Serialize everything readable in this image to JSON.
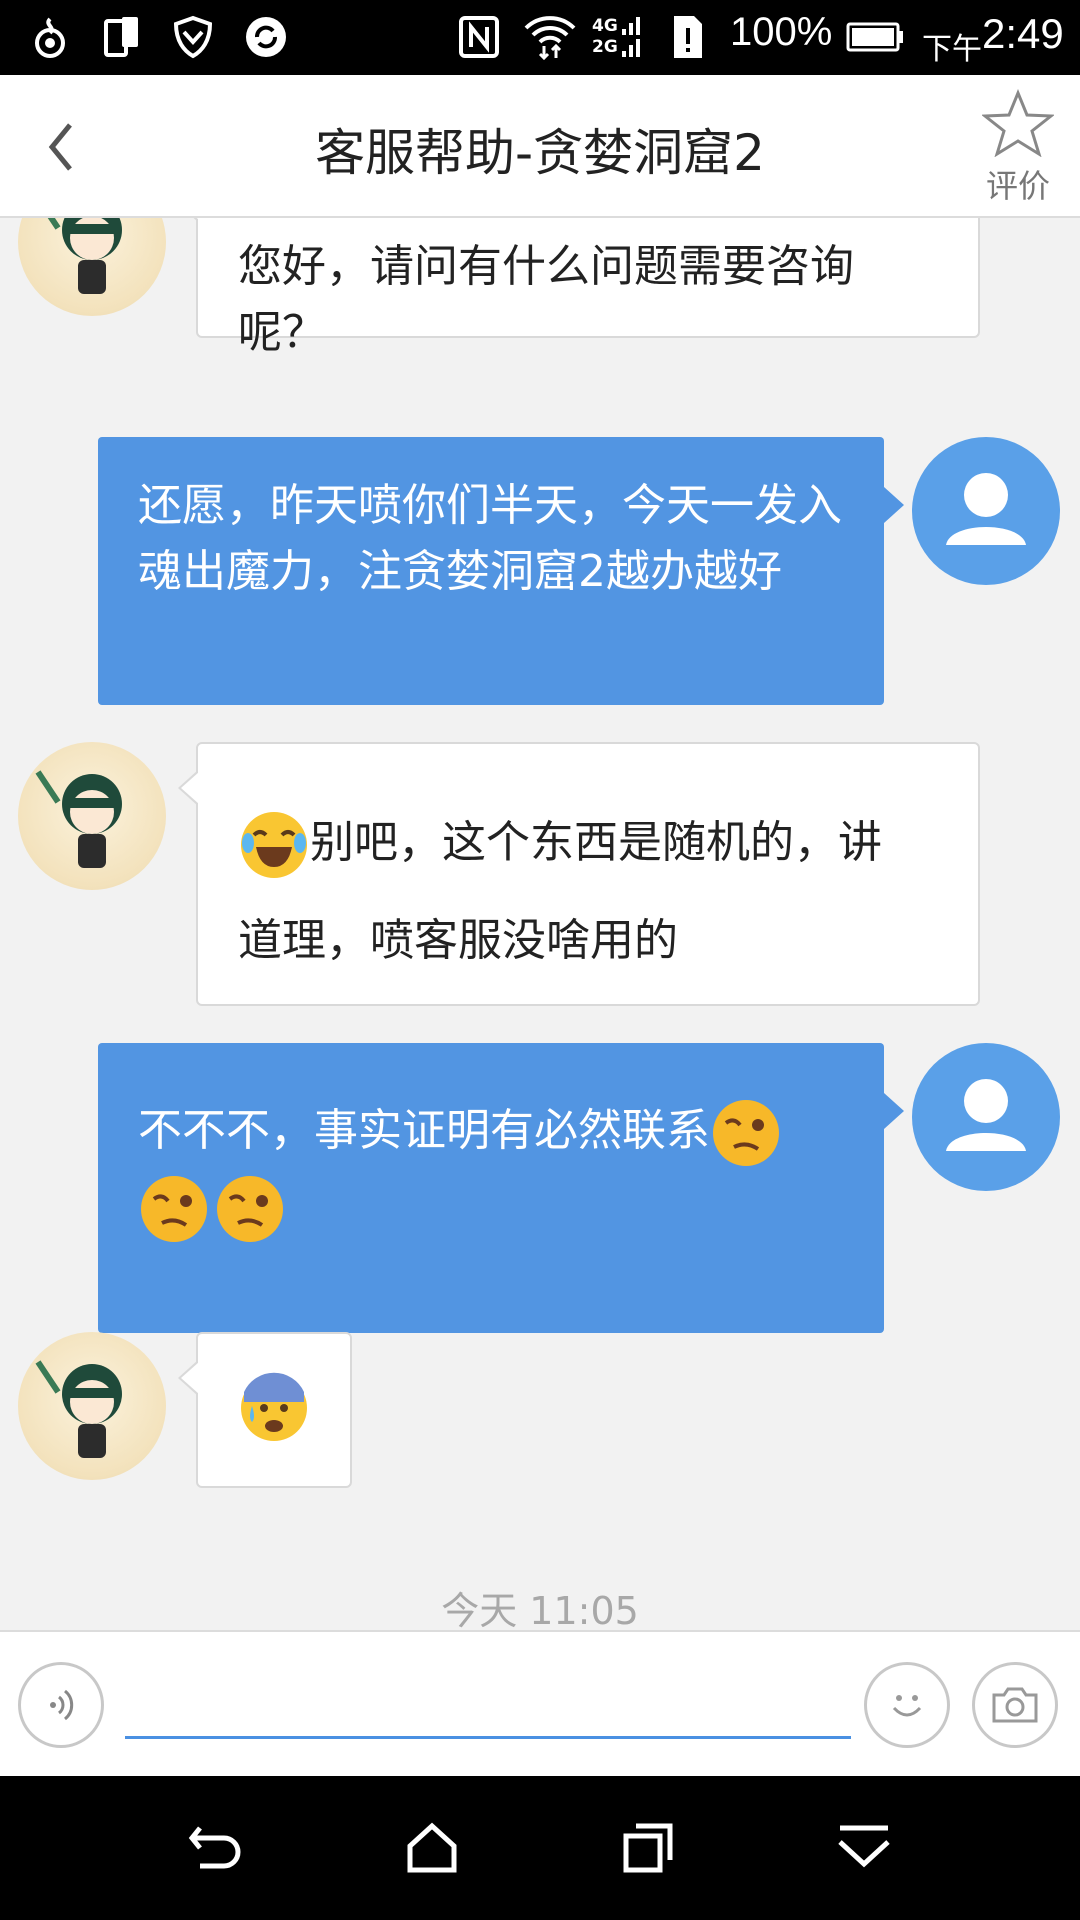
{
  "status_bar": {
    "battery": "100%",
    "time_prefix": "下午",
    "time": "2:49",
    "net_4g": "4G",
    "net_2g": "2G"
  },
  "header": {
    "title": "客服帮助-贪婪洞窟2",
    "rate_label": "评价"
  },
  "messages": [
    {
      "side": "in",
      "text": "您好，请问有什么问题需要咨询呢？"
    },
    {
      "side": "out",
      "text": "还愿，昨天喷你们半天，今天一发入魂出魔力，注贪婪洞窟2越办越好"
    },
    {
      "side": "in",
      "emoji": "laugh-cry-emoji",
      "text_a": "别吧，这个东西是随机的，讲",
      "text_b": "道理，喷客服没啥用的"
    },
    {
      "side": "out",
      "text": "不不不，事实证明有必然联系",
      "emoji": "wink-emoji"
    },
    {
      "side": "in",
      "emoji": "anxious-sweat-emoji"
    }
  ],
  "timestamp": "今天 11:05",
  "input": {
    "value": "",
    "placeholder": ""
  },
  "colors": {
    "accent": "#5295e2",
    "user_avatar": "#5aa0e8",
    "background": "#f2f2f2"
  }
}
